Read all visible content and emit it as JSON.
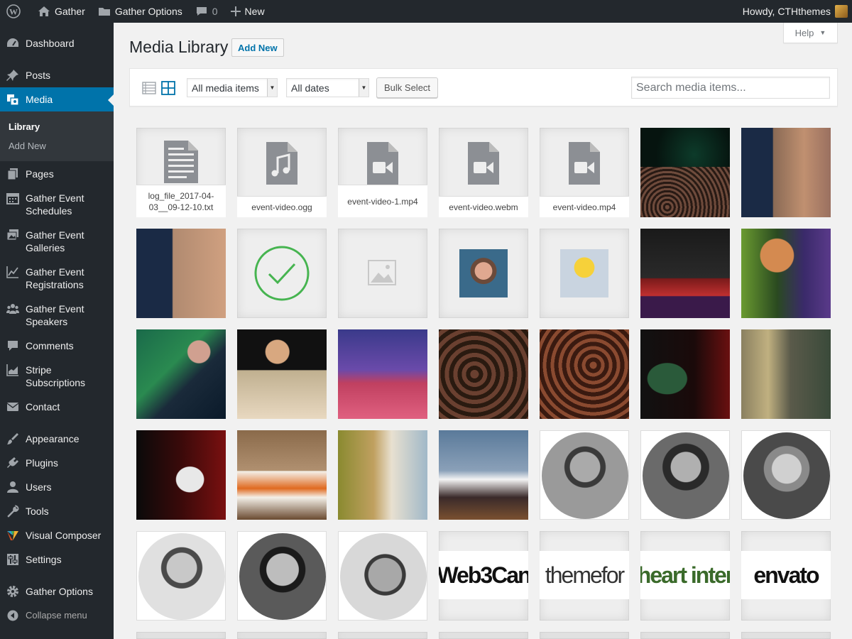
{
  "admin_bar": {
    "site_name": "Gather",
    "options_label": "Gather Options",
    "comments_count": "0",
    "new_label": "New",
    "greeting": "Howdy, CTHthemes"
  },
  "sidebar": {
    "items": [
      {
        "label": "Dashboard",
        "icon": "dashboard-icon"
      },
      {
        "label": "Posts",
        "icon": "pin-icon"
      },
      {
        "label": "Media",
        "icon": "media-icon"
      },
      {
        "label": "Pages",
        "icon": "pages-icon"
      },
      {
        "label": "Gather Event Schedules",
        "icon": "calendar-icon"
      },
      {
        "label": "Gather Event Galleries",
        "icon": "gallery-icon"
      },
      {
        "label": "Gather Event Registrations",
        "icon": "chart-line-icon"
      },
      {
        "label": "Gather Event Speakers",
        "icon": "groups-icon"
      },
      {
        "label": "Comments",
        "icon": "comment-icon"
      },
      {
        "label": "Stripe Subscriptions",
        "icon": "chart-bar-icon"
      },
      {
        "label": "Contact",
        "icon": "envelope-icon"
      },
      {
        "label": "Appearance",
        "icon": "brush-icon"
      },
      {
        "label": "Plugins",
        "icon": "plug-icon"
      },
      {
        "label": "Users",
        "icon": "user-icon"
      },
      {
        "label": "Tools",
        "icon": "wrench-icon"
      },
      {
        "label": "Visual Composer",
        "icon": "visual-composer-icon"
      },
      {
        "label": "Settings",
        "icon": "settings-icon"
      },
      {
        "label": "Gather Options",
        "icon": "gear-icon"
      }
    ],
    "submenu": {
      "library": "Library",
      "add_new": "Add New"
    },
    "collapse": "Collapse menu"
  },
  "header": {
    "help": "Help",
    "title": "Media Library",
    "add_new": "Add New"
  },
  "toolbar": {
    "filter_type": "All media items",
    "filter_date": "All dates",
    "bulk_select": "Bulk Select",
    "search_placeholder": "Search media items..."
  },
  "files": [
    {
      "name": "log_file_2017-04-03__09-12-10.txt",
      "icon": "document-icon"
    },
    {
      "name": "event-video.ogg",
      "icon": "audio-file-icon"
    },
    {
      "name": "event-video-1.mp4",
      "icon": "video-file-icon"
    },
    {
      "name": "event-video.webm",
      "icon": "video-file-icon"
    },
    {
      "name": "event-video.mp4",
      "icon": "video-file-icon"
    }
  ],
  "logos": [
    {
      "text": "Web3Can"
    },
    {
      "text": "themefor"
    },
    {
      "text": "heart inter"
    },
    {
      "text": "envato"
    }
  ],
  "colors": {
    "admin_bar": "#23282d",
    "accent": "#0073aa",
    "checkmark": "#46b450"
  }
}
